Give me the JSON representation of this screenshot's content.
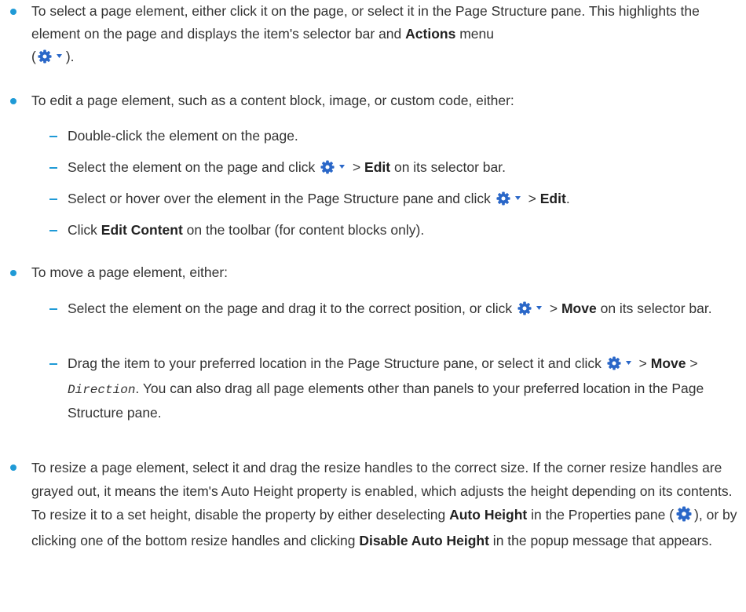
{
  "colors": {
    "accent": "#1f9ad6",
    "gear": "#2a67c8"
  },
  "icons": {
    "actions_menu": "gear-dropdown-icon",
    "properties": "gear-icon"
  },
  "select": {
    "text_a": "To select a page element, either click it on the page, or select it in the Page Structure pane. This highlights the element on the page and displays the item's selector bar and ",
    "bold_a": "Actions",
    "text_b": " menu",
    "paren_open": "(",
    "paren_close": ")."
  },
  "edit": {
    "intro": "To edit a page element, such as a content block, image, or custom code, either:",
    "opt1": "Double-click the element on the page.",
    "opt2_a": "Select the element on the page and click ",
    "opt2_sep": " > ",
    "opt2_bold": "Edit",
    "opt2_b": " on its selector bar.",
    "opt3_a": "Select or hover over the element in the Page Structure pane and click ",
    "opt3_sep": " > ",
    "opt3_bold": "Edit",
    "opt3_end": ".",
    "opt4_a": "Click ",
    "opt4_bold": "Edit Content",
    "opt4_b": " on the toolbar (for content blocks only)."
  },
  "move": {
    "intro": "To move a page element, either:",
    "opt1_a": "Select the element on the page and drag it to the correct position, or click ",
    "opt1_sep": " > ",
    "opt1_bold": "Move",
    "opt1_b": " on its selector bar.",
    "opt2_a": "Drag the item to your preferred location in the Page Structure pane, or select it and click ",
    "opt2_sep1": " > ",
    "opt2_bold": "Move",
    "opt2_sep2": " > ",
    "opt2_code": "Direction",
    "opt2_b": ". You can also drag all page elements other than panels to your preferred location in the Page Structure pane."
  },
  "resize": {
    "text_a": "To resize a page element, select it and drag the resize handles to the correct size. If the corner resize handles are grayed out, it means the item's Auto Height property is enabled, which adjusts the height depending on its contents. To resize it to a set height, disable the property by either deselecting ",
    "bold_a": "Auto Height",
    "text_b": " in the Properties pane (",
    "text_c": "), or by clicking one of the bottom resize handles and clicking ",
    "bold_b": "Disable Auto Height",
    "text_d": " in the popup message that appears."
  }
}
